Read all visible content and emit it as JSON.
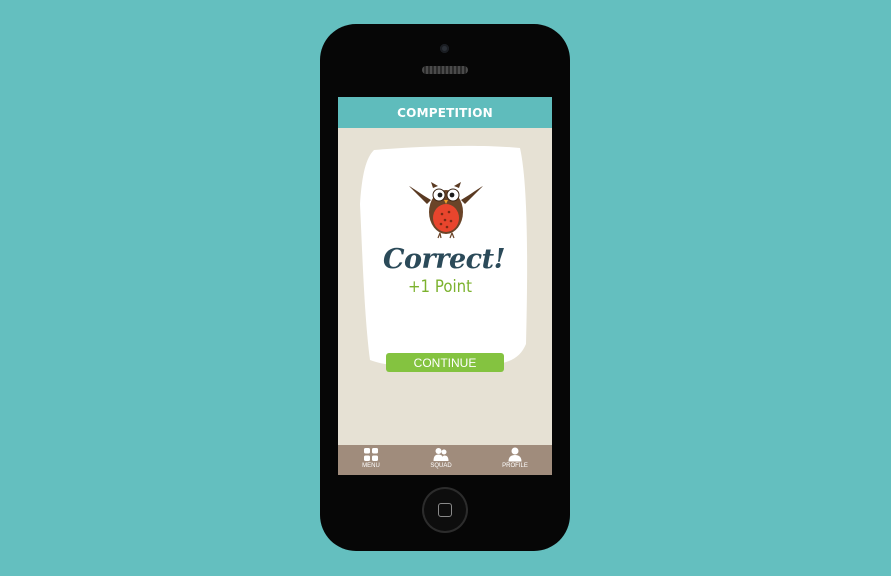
{
  "screen": {
    "header_title": "COMPETITION"
  },
  "result": {
    "title": "Correct!",
    "points": "+1 Point",
    "continue_label": "CONTINUE"
  },
  "tabs": [
    {
      "label": "MENU",
      "icon": "grid-icon"
    },
    {
      "label": "SQUAD",
      "icon": "group-icon"
    },
    {
      "label": "PROFILE",
      "icon": "person-icon"
    }
  ],
  "colors": {
    "background": "#64bfbf",
    "header": "#5fbcbc",
    "screen": "#e6e1d4",
    "title": "#2b4a59",
    "points": "#7cb22e",
    "button": "#84c340",
    "tabbar": "#a08c7c"
  }
}
